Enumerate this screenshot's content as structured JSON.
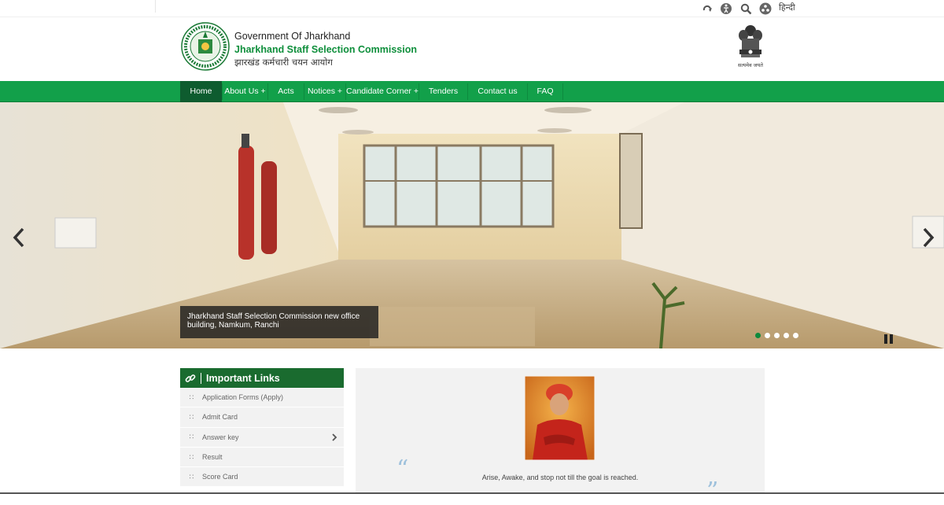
{
  "toolbar": {
    "icons": [
      "screen-reader-icon",
      "accessibility-icon",
      "search-icon",
      "sitemap-icon"
    ],
    "language": "हिन्दी"
  },
  "header": {
    "gov_line": "Government Of Jharkhand",
    "commission_name": "Jharkhand Staff Selection Commission",
    "hindi_name": "झारखंड कर्मचारी चयन आयोग",
    "emblem_text": "सत्यमेव जयते"
  },
  "nav": {
    "items": [
      {
        "label": "Home"
      },
      {
        "label": "About Us +"
      },
      {
        "label": "Acts"
      },
      {
        "label": "Notices +"
      },
      {
        "label": "Candidate Corner +"
      },
      {
        "label": "Tenders"
      },
      {
        "label": "Contact us"
      },
      {
        "label": "FAQ"
      }
    ]
  },
  "slider": {
    "caption": "Jharkhand Staff Selection Commission new office building, Namkum, Ranchi",
    "slide_count": 5,
    "active_slide": 1
  },
  "important_links": {
    "title": "Important Links",
    "items": [
      {
        "label": "Application Forms (Apply)"
      },
      {
        "label": "Admit Card"
      },
      {
        "label": "Answer key"
      },
      {
        "label": "Result"
      },
      {
        "label": "Score Card"
      }
    ]
  },
  "quote": {
    "open_mark": "“",
    "close_mark": "”",
    "text": "Arise, Awake, and stop not till the goal is reached."
  },
  "colors": {
    "nav_green": "#12a04a",
    "active_nav": "#0e5c2f",
    "links_header": "#1a6b2f",
    "commission_text": "#0f8f3c"
  }
}
